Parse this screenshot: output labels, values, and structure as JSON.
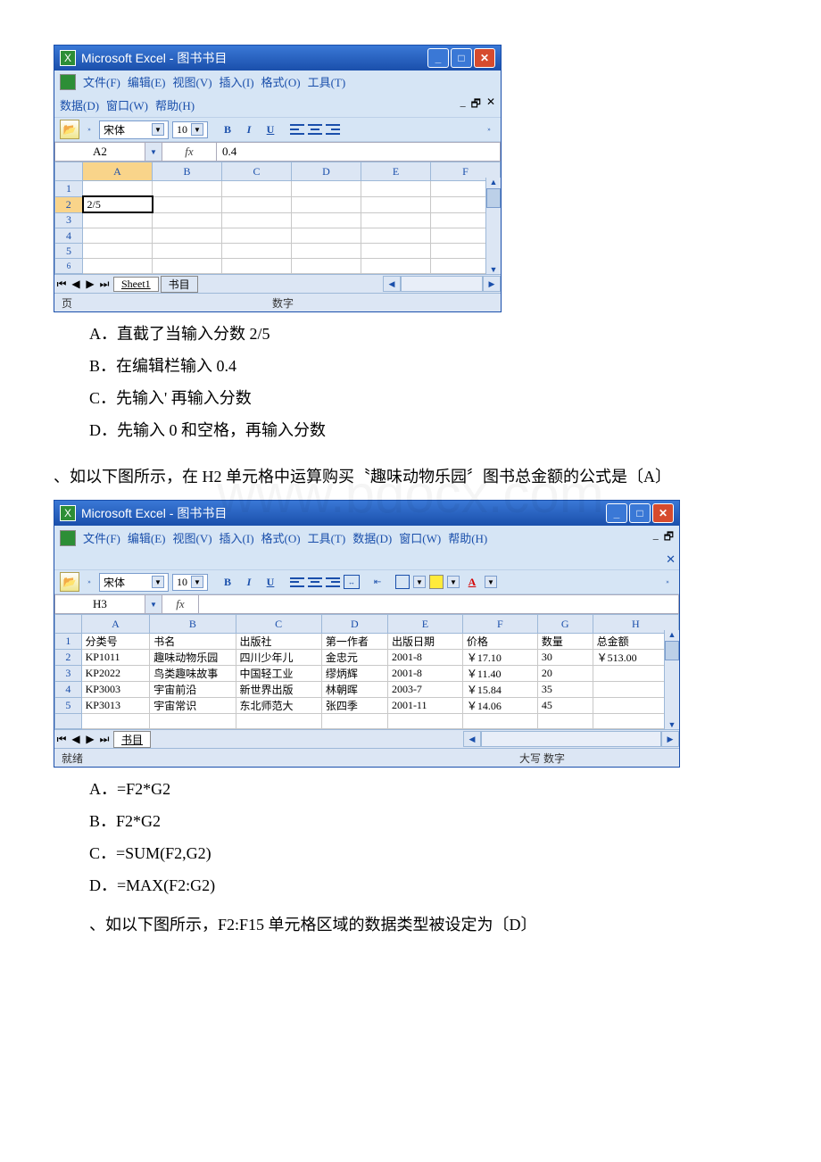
{
  "excel1": {
    "title": "Microsoft Excel - 图书书目",
    "menu": {
      "file": "文件(F)",
      "edit": "编辑(E)",
      "view": "视图(V)",
      "insert": "插入(I)",
      "format": "格式(O)",
      "tools": "工具(T)",
      "data": "数据(D)",
      "window": "窗口(W)",
      "help": "帮助(H)"
    },
    "font_name": "宋体",
    "font_size": "10",
    "name_box": "A2",
    "fx_label": "fx",
    "formula_value": "0.4",
    "columns": [
      "A",
      "B",
      "C",
      "D",
      "E",
      "F"
    ],
    "cell_A2": "2/5",
    "sheet_tabs": [
      "Sheet1",
      "书目"
    ],
    "status_left": "页",
    "status_center": "数字"
  },
  "q1": {
    "optA": "A．直截了当输入分数 2/5",
    "optB": "B．在编辑栏输入 0.4",
    "optC": "C．先输入' 再输入分数",
    "optD": "D．先输入 0 和空格，再输入分数"
  },
  "q2_text": "、如以下图所示，在 H2 单元格中运算购买〝趣味动物乐园〞图书总金额的公式是〔A〕",
  "excel2": {
    "title": "Microsoft Excel - 图书书目",
    "menu": {
      "file": "文件(F)",
      "edit": "编辑(E)",
      "view": "视图(V)",
      "insert": "插入(I)",
      "format": "格式(O)",
      "tools": "工具(T)",
      "data": "数据(D)",
      "window": "窗口(W)",
      "help": "帮助(H)"
    },
    "font_name": "宋体",
    "font_size": "10",
    "name_box": "H3",
    "fx_label": "fx",
    "columns": [
      "A",
      "B",
      "C",
      "D",
      "E",
      "F",
      "G",
      "H"
    ],
    "headers": {
      "A": "分类号",
      "B": "书名",
      "C": "出版社",
      "D": "第一作者",
      "E": "出版日期",
      "F": "价格",
      "G": "数量",
      "H": "总金额"
    },
    "rows": [
      {
        "A": "KP1011",
        "B": "趣味动物乐园",
        "C": "四川少年儿",
        "D": "金忠元",
        "E": "2001-8",
        "F": "￥17.10",
        "G": "30",
        "H": "￥513.00"
      },
      {
        "A": "KP2022",
        "B": "鸟类趣味故事",
        "C": "中国轻工业",
        "D": "缪炳辉",
        "E": "2001-8",
        "F": "￥11.40",
        "G": "20",
        "H": ""
      },
      {
        "A": "KP3003",
        "B": "宇宙前沿",
        "C": "新世界出版",
        "D": "林朝晖",
        "E": "2003-7",
        "F": "￥15.84",
        "G": "35",
        "H": ""
      },
      {
        "A": "KP3013",
        "B": "宇宙常识",
        "C": "东北师范大",
        "D": "张四季",
        "E": "2001-11",
        "F": "￥14.06",
        "G": "45",
        "H": ""
      },
      {
        "A": "",
        "B": "",
        "C": "",
        "D": "",
        "E": "",
        "F": "",
        "G": "",
        "H": ""
      }
    ],
    "sheet_tab": "书目",
    "status_left": "就绪",
    "status_right": "大写 数字"
  },
  "q2": {
    "optA": "A．=F2*G2",
    "optB": "B．F2*G2",
    "optC": "C．=SUM(F2,G2)",
    "optD": "D．=MAX(F2:G2)"
  },
  "q3_text": "、如以下图所示，F2:F15 单元格区域的数据类型被设定为〔D〕"
}
